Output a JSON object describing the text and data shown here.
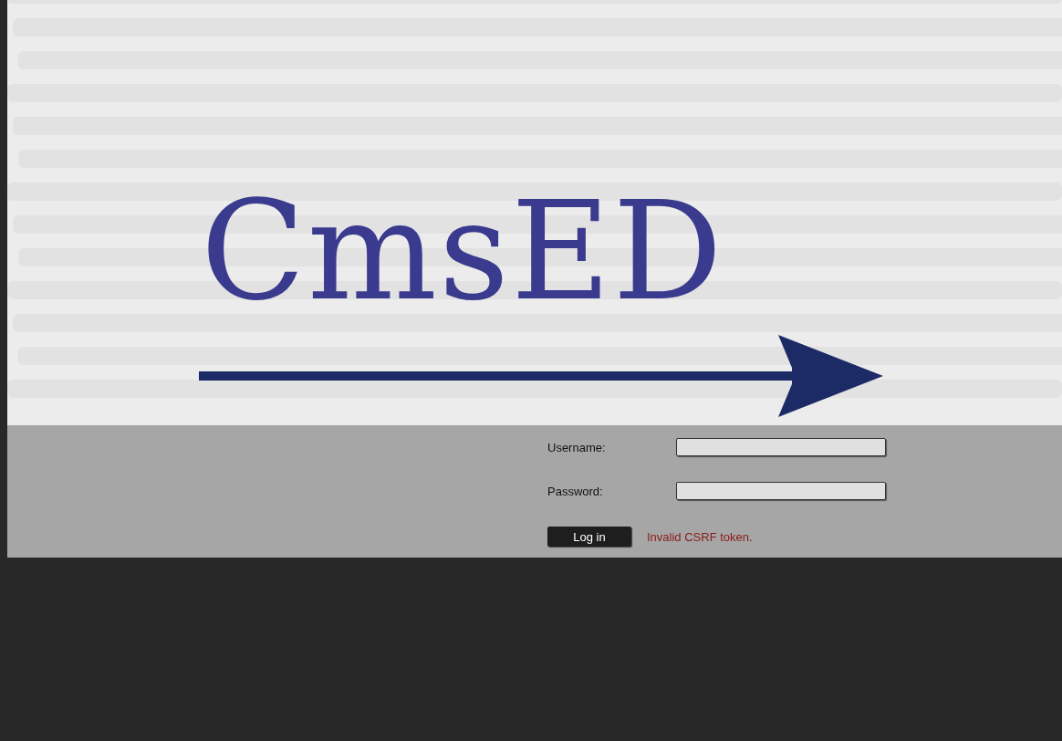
{
  "banner": {
    "logo": "CmsED"
  },
  "login": {
    "fields": [
      {
        "label": "Username:"
      },
      {
        "label": "Password:"
      }
    ],
    "button": "Log in",
    "error": "Invalid CSRF token."
  }
}
